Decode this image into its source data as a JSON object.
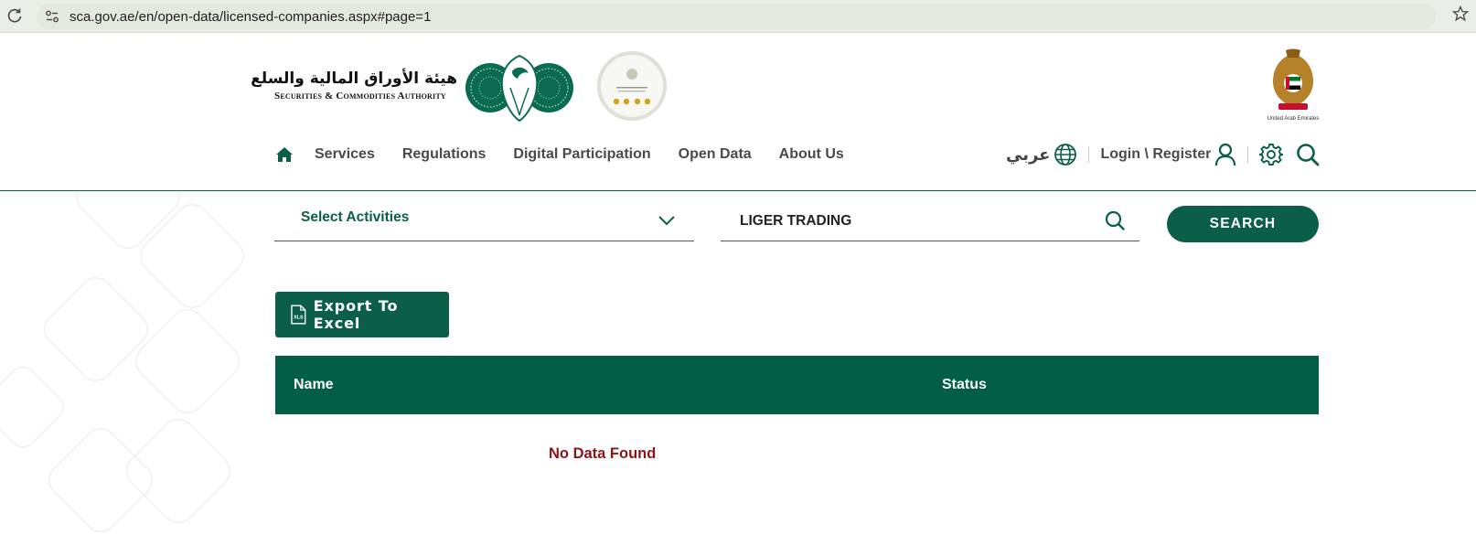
{
  "browser": {
    "url": "sca.gov.ae/en/open-data/licensed-companies.aspx#page=1"
  },
  "header": {
    "logo_arabic": "هيئة الأوراق المالية والسلع",
    "logo_english": "Securities & Commodities Authority",
    "nav": {
      "services": "Services",
      "regulations": "Regulations",
      "digital_participation": "Digital Participation",
      "open_data": "Open Data",
      "about_us": "About Us"
    },
    "language": "عربي",
    "login": "Login \\ Register"
  },
  "filters": {
    "activity_select": "Select Activities",
    "search_value": "LIGER TRADING",
    "search_button": "SEARCH"
  },
  "export": {
    "label": "Export To Excel"
  },
  "table": {
    "columns": [
      "Name",
      "Status"
    ],
    "empty_message": "No Data Found"
  },
  "colors": {
    "brand_green": "#0b5e4a",
    "error_red": "#8b1414"
  }
}
